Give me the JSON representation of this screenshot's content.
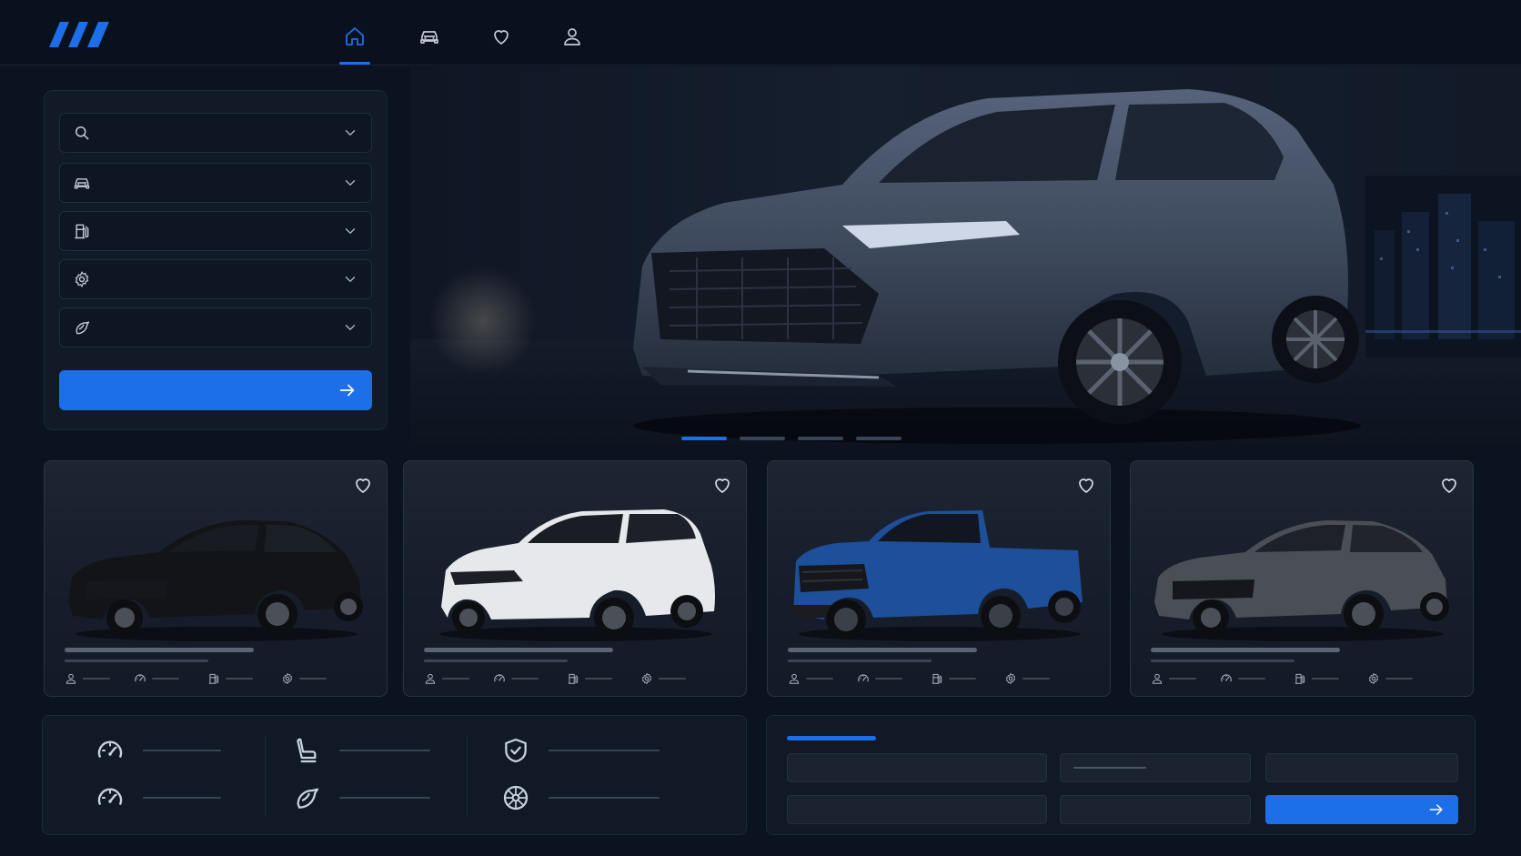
{
  "header": {
    "logo": "brand-logo",
    "nav": [
      {
        "icon": "home-icon",
        "active": true
      },
      {
        "icon": "car-icon",
        "active": false
      },
      {
        "icon": "heart-icon",
        "active": false
      },
      {
        "icon": "user-icon",
        "active": false
      }
    ]
  },
  "filters": {
    "rows": [
      {
        "icon": "search-icon",
        "value": ""
      },
      {
        "icon": "car-icon",
        "value": ""
      },
      {
        "icon": "fuel-icon",
        "value": ""
      },
      {
        "icon": "gear-icon",
        "value": ""
      },
      {
        "icon": "engine-icon",
        "value": ""
      }
    ],
    "submit_icon": "arrow-right-icon"
  },
  "hero": {
    "slides": 4,
    "active_slide": 1
  },
  "listings": [
    {
      "body_color": "#121417",
      "style": "sedan"
    },
    {
      "body_color": "#e6e8ec",
      "style": "suv"
    },
    {
      "body_color": "#1d4f9a",
      "style": "truck"
    },
    {
      "body_color": "#4a4e55",
      "style": "sedan"
    }
  ],
  "listing_spec_icons": [
    "user-icon",
    "speedometer-icon",
    "fuel-icon",
    "gear-icon"
  ],
  "features": [
    {
      "icon": "speedometer-icon"
    },
    {
      "icon": "speedometer-icon"
    },
    {
      "icon": "seat-icon"
    },
    {
      "icon": "engine-icon"
    },
    {
      "icon": "shield-check-icon"
    },
    {
      "icon": "wheel-icon"
    }
  ],
  "booking": {
    "submit_icon": "arrow-right-icon"
  },
  "colors": {
    "accent": "#1c6fe8",
    "background": "#0b1220",
    "panel": "#121a28"
  }
}
